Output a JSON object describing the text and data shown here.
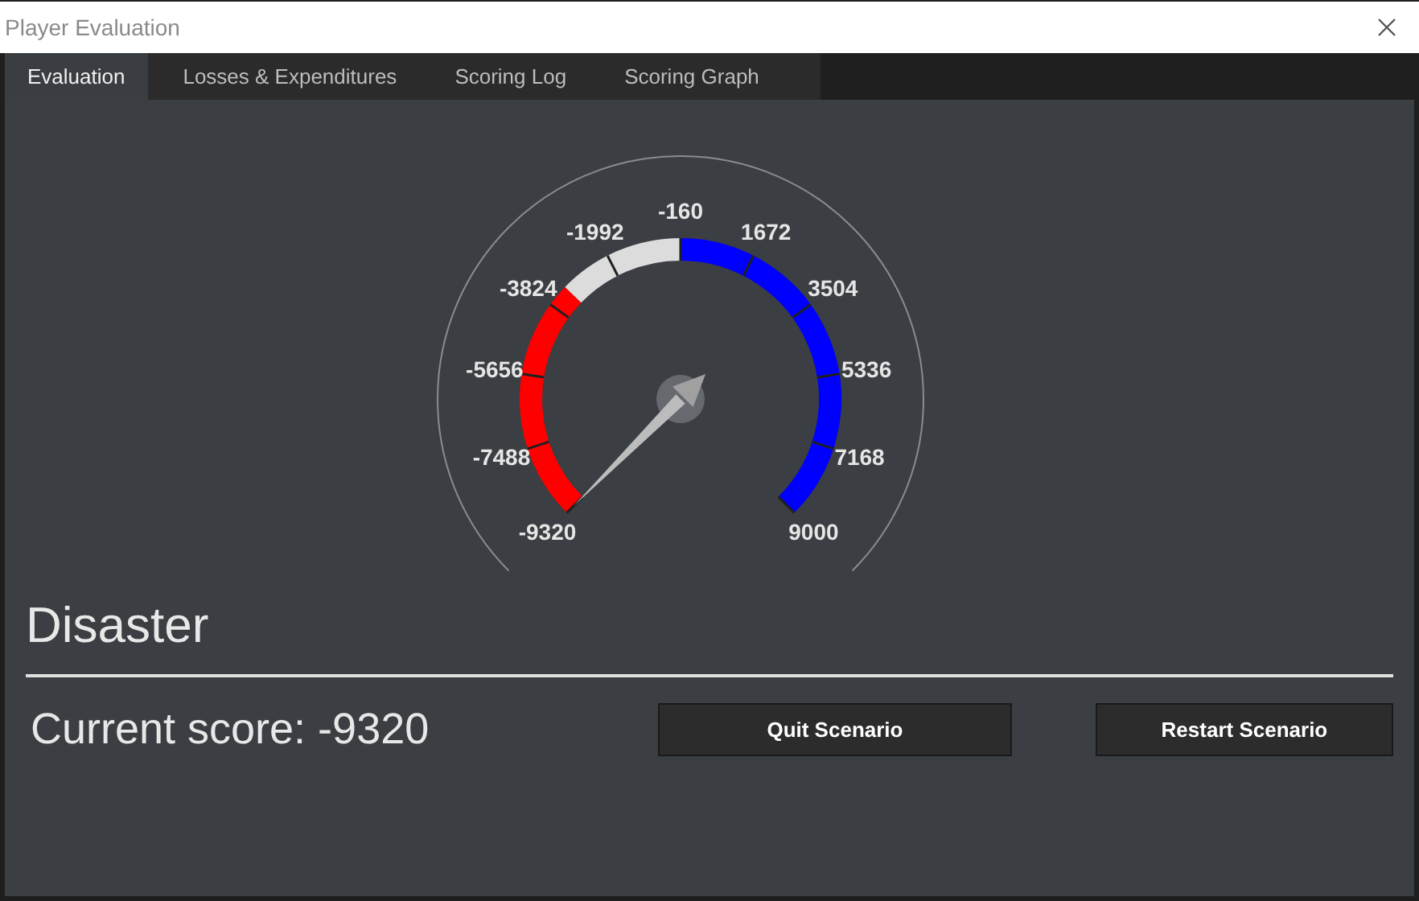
{
  "window": {
    "title": "Player Evaluation"
  },
  "tabs": [
    {
      "label": "Evaluation",
      "selected": true
    },
    {
      "label": "Losses & Expenditures",
      "selected": false
    },
    {
      "label": "Scoring Log",
      "selected": false
    },
    {
      "label": "Scoring Graph",
      "selected": false
    }
  ],
  "gauge": {
    "ticks": [
      "-9320",
      "-7488",
      "-5656",
      "-3824",
      "-1992",
      "-160",
      "1672",
      "3504",
      "5336",
      "7168",
      "9000"
    ],
    "bands": [
      {
        "color": "#ff0000"
      },
      {
        "color": "#dcdcdc"
      },
      {
        "color": "#0000ff"
      }
    ]
  },
  "rating": "Disaster",
  "score": "Current score: -9320",
  "buttons": [
    {
      "label": "Quit Scenario"
    },
    {
      "label": "Restart Scenario"
    }
  ]
}
